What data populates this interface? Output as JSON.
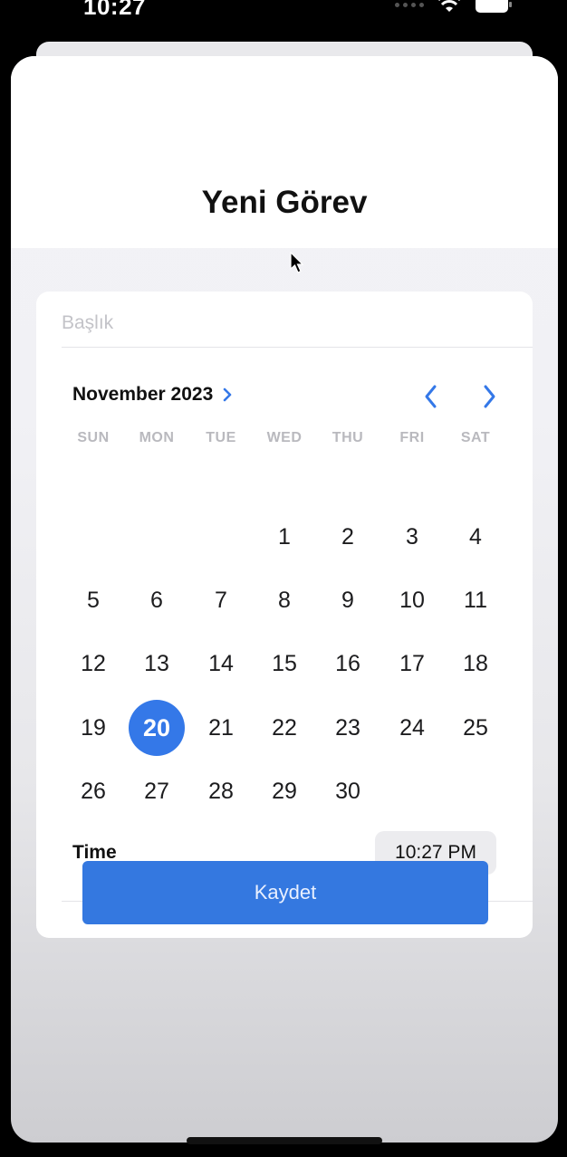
{
  "status_bar": {
    "time": "10:27"
  },
  "sheet": {
    "title": "Yeni Görev"
  },
  "form": {
    "title_placeholder": "Başlık",
    "title_value": ""
  },
  "calendar": {
    "month_label": "November 2023",
    "weekdays": [
      "SUN",
      "MON",
      "TUE",
      "WED",
      "THU",
      "FRI",
      "SAT"
    ],
    "days": [
      "1",
      "2",
      "3",
      "4",
      "5",
      "6",
      "7",
      "8",
      "9",
      "10",
      "11",
      "12",
      "13",
      "14",
      "15",
      "16",
      "17",
      "18",
      "19",
      "20",
      "21",
      "22",
      "23",
      "24",
      "25",
      "26",
      "27",
      "28",
      "29",
      "30"
    ],
    "selected_day": "20",
    "accent_color": "#3478E8"
  },
  "time_row": {
    "label": "Time",
    "value": "10:27 PM"
  },
  "save_button": {
    "label": "Kaydet",
    "color": "#3478E0"
  },
  "icons": {
    "month_expand": "chevron-right-icon",
    "prev_month": "chevron-left-icon",
    "next_month": "chevron-right-icon",
    "wifi": "wifi-icon",
    "battery": "battery-icon",
    "cursor": "mouse-pointer-icon"
  }
}
